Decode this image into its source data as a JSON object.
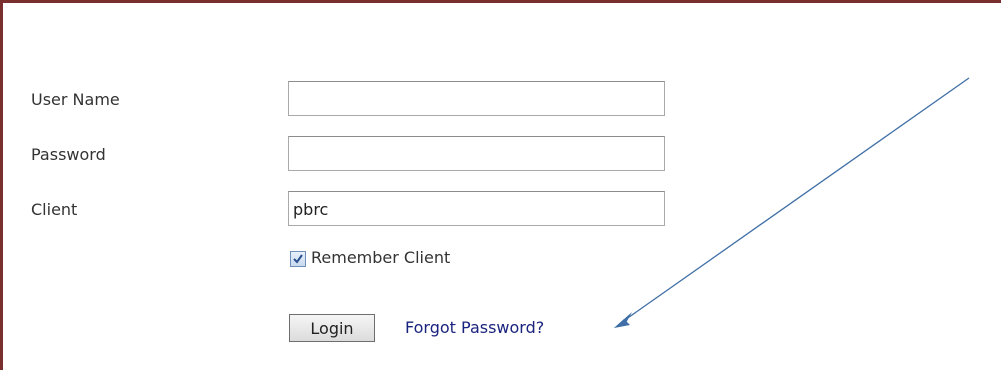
{
  "form": {
    "username_label": "User Name",
    "password_label": "Password",
    "client_label": "Client",
    "username_value": "",
    "password_value": "",
    "client_value": "pbrc",
    "remember_label": "Remember Client",
    "remember_checked": true,
    "login_label": "Login",
    "forgot_label": "Forgot Password?"
  },
  "colors": {
    "panel_border": "#7b2e2e",
    "link": "#1a237e",
    "annotation_arrow": "#3f6fa6"
  },
  "annotation": {
    "icon": "arrow-icon"
  }
}
